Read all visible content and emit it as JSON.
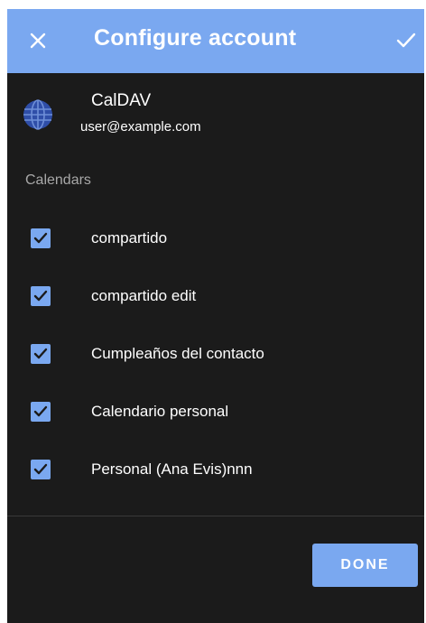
{
  "toolbar": {
    "title": "Configure account",
    "close_icon": "close-icon",
    "confirm_icon": "check-icon"
  },
  "account": {
    "type": "CalDAV",
    "email": "user@example.com",
    "icon": "globe-icon"
  },
  "calendars": {
    "section_label": "Calendars",
    "items": [
      {
        "label": "compartido",
        "checked": true
      },
      {
        "label": "compartido edit",
        "checked": true
      },
      {
        "label": "Cumpleaños del contacto",
        "checked": true
      },
      {
        "label": "Calendario personal",
        "checked": true
      },
      {
        "label": "Personal (Ana Evis)nnn",
        "checked": true
      }
    ]
  },
  "footer": {
    "done_label": "DONE"
  },
  "colors": {
    "accent": "#7aa8f0",
    "background": "#1b1b1b",
    "globe": "#2f4ea8",
    "text": "#ffffff",
    "secondary_text": "#a8a8a8"
  }
}
